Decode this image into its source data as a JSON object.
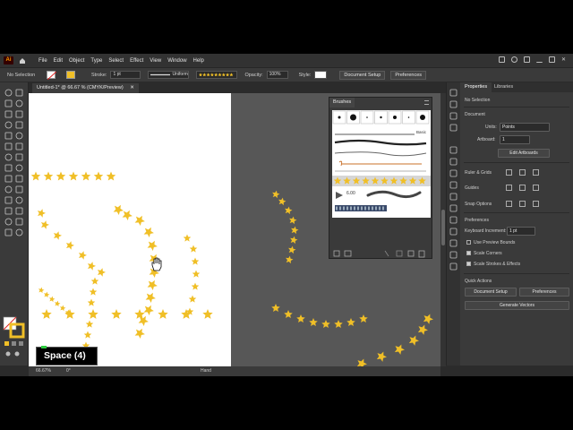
{
  "app": {
    "logo": "Ai",
    "menu": [
      "File",
      "Edit",
      "Object",
      "Type",
      "Select",
      "Effect",
      "View",
      "Window",
      "Help"
    ]
  },
  "control_bar": {
    "selection_text": "No Selection",
    "stroke_label": "Stroke:",
    "stroke_value": "1 pt",
    "profile_value": "Uniform",
    "opacity_label": "Opacity:",
    "opacity_value": "100%",
    "style_label": "Style:",
    "document_setup": "Document Setup",
    "preferences": "Preferences"
  },
  "document": {
    "tab_title": "Untitled-1* @ 66.67 % (CMYK/Preview)"
  },
  "brushes_panel": {
    "title": "Brushes",
    "basic_label": "Basic",
    "brush_size": "6.00"
  },
  "properties_panel": {
    "tabs": [
      "Properties",
      "Libraries"
    ],
    "selection": "No Selection",
    "document_heading": "Document",
    "units_label": "Units:",
    "units_value": "Points",
    "artboard_label": "Artboard:",
    "artboard_value": "1",
    "edit_artboards": "Edit Artboards",
    "ruler_grids": "Ruler & Grids",
    "guides": "Guides",
    "snap_options": "Snap Options",
    "preferences_heading": "Preferences",
    "keyboard_increment_label": "Keyboard Increment:",
    "keyboard_increment_value": "1 pt",
    "use_preview_bounds": "Use Preview Bounds",
    "scale_corners": "Scale Corners",
    "scale_strokes": "Scale Strokes & Effects",
    "quick_actions": "Quick Actions",
    "document_setup": "Document Setup",
    "preferences": "Preferences",
    "generate_vectors": "Generate Vectors"
  },
  "status_bar": {
    "zoom": "66.67%",
    "rotation": "0°",
    "tool": "Hand"
  },
  "overlay": {
    "key_label": "Space (4)"
  },
  "colors": {
    "accent_star": "#f0bf27",
    "canvas_bg": "#575757",
    "panel_bg": "#3a3a3a",
    "fill_swatch": "#f0bf27"
  }
}
